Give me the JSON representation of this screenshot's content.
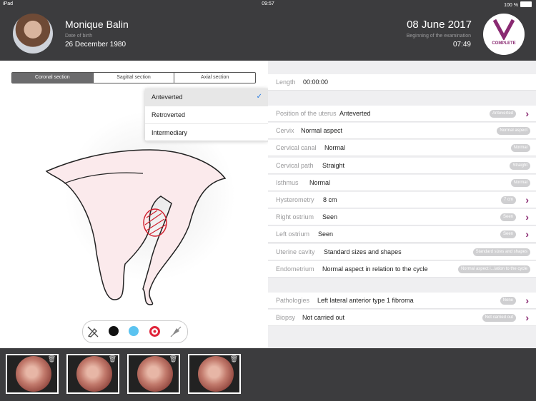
{
  "status": {
    "device": "iPad",
    "time": "09:57",
    "battery": "100 %"
  },
  "patient": {
    "name": "Monique Balin",
    "dob_label": "Date of birth",
    "dob": "26 December 1980"
  },
  "exam": {
    "date": "08 June 2017",
    "label": "Beginning of the examination",
    "time": "07:49",
    "status": "COMPLETE"
  },
  "sections": [
    "Coronal section",
    "Sagittal section",
    "Axial section"
  ],
  "dropdown": [
    "Anteverted",
    "Retroverted",
    "Intermediary"
  ],
  "length": {
    "label": "Length",
    "value": "00:00:00"
  },
  "fields": [
    {
      "label": "Position of the uterus",
      "value": "Anteverted",
      "badge": "Anteverted"
    },
    {
      "label": "Cervix",
      "value": "Normal aspect",
      "badge": "Normal aspect"
    },
    {
      "label": "Cervical canal",
      "value": "Normal",
      "badge": "Normal"
    },
    {
      "label": "Cervical path",
      "value": "Straight",
      "badge": "Straight"
    },
    {
      "label": "Isthmus",
      "value": "Normal",
      "badge": "Normal"
    },
    {
      "label": "Hysterometry",
      "value": "8 cm",
      "badge": "7 cm"
    },
    {
      "label": "Right ostrium",
      "value": "Seen",
      "badge": "Seen"
    },
    {
      "label": "Left ostrium",
      "value": "Seen",
      "badge": "Seen"
    },
    {
      "label": "Uterine cavity",
      "value": "Standard sizes and shapes",
      "badge": "Standard sizes and shapes"
    },
    {
      "label": "Endometrium",
      "value": "Normal aspect in relation to the cycle",
      "badge": "Normal aspect i...lation to the cycle"
    }
  ],
  "other": [
    {
      "label": "Pathologies",
      "value": "Left lateral anterior type 1 fibroma",
      "badge": "None"
    },
    {
      "label": "Biopsy",
      "value": "Not carried out",
      "badge": "Not carried out"
    }
  ],
  "colors": {
    "accent": "#8a2a72",
    "black": "#111111",
    "blue": "#5bc3f0",
    "red": "#e0243a"
  }
}
